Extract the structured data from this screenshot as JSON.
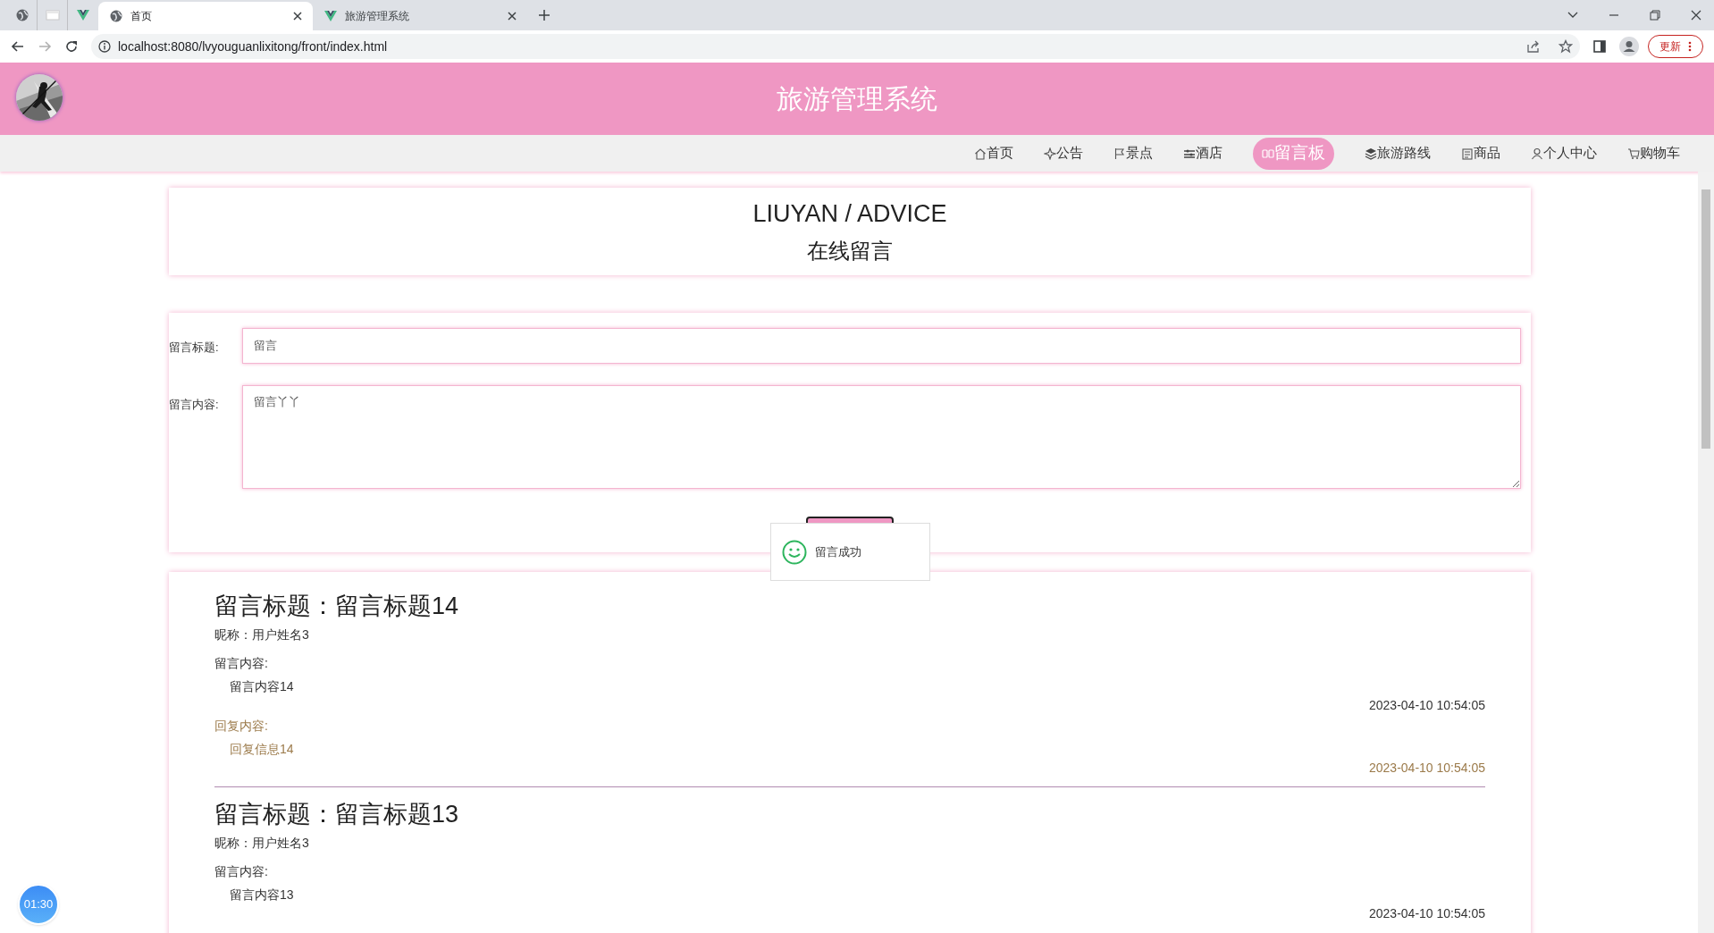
{
  "browser": {
    "tabs": [
      {
        "title": "首页",
        "selected": true
      },
      {
        "title": "旅游管理系统",
        "selected": false
      }
    ],
    "address": "localhost:8080/lvyouguanlixitong/front/index.html",
    "update_button": "更新"
  },
  "header": {
    "title": "旅游管理系统"
  },
  "nav": [
    {
      "label": "首页",
      "selected": false
    },
    {
      "label": "公告",
      "selected": false
    },
    {
      "label": "景点",
      "selected": false
    },
    {
      "label": "酒店",
      "selected": false
    },
    {
      "label": "留言板",
      "selected": true
    },
    {
      "label": "旅游路线",
      "selected": false
    },
    {
      "label": "商品",
      "selected": false
    },
    {
      "label": "个人中心",
      "selected": false
    },
    {
      "label": "购物车",
      "selected": false
    }
  ],
  "section": {
    "title": "LIUYAN / ADVICE",
    "subtitle": "在线留言"
  },
  "form": {
    "fields": [
      {
        "kind": "input",
        "label": "留言标题:",
        "value": "留言"
      },
      {
        "kind": "textarea",
        "label": "留言内容:",
        "value": "留言丫丫"
      }
    ]
  },
  "toast": {
    "text": "留言成功"
  },
  "messages": [
    {
      "title": "留言标题：留言标题14",
      "nickname": "昵称：用户姓名3",
      "content_label": "留言内容:",
      "content": "留言内容14",
      "time": "2023-04-10 10:54:05",
      "reply_label": "回复内容:",
      "reply": "回复信息14",
      "reply_time": "2023-04-10 10:54:05"
    },
    {
      "title": "留言标题：留言标题13",
      "nickname": "昵称：用户姓名3",
      "content_label": "留言内容:",
      "content": "留言内容13",
      "time": "2023-04-10 10:54:05"
    }
  ],
  "timer": "01:30"
}
